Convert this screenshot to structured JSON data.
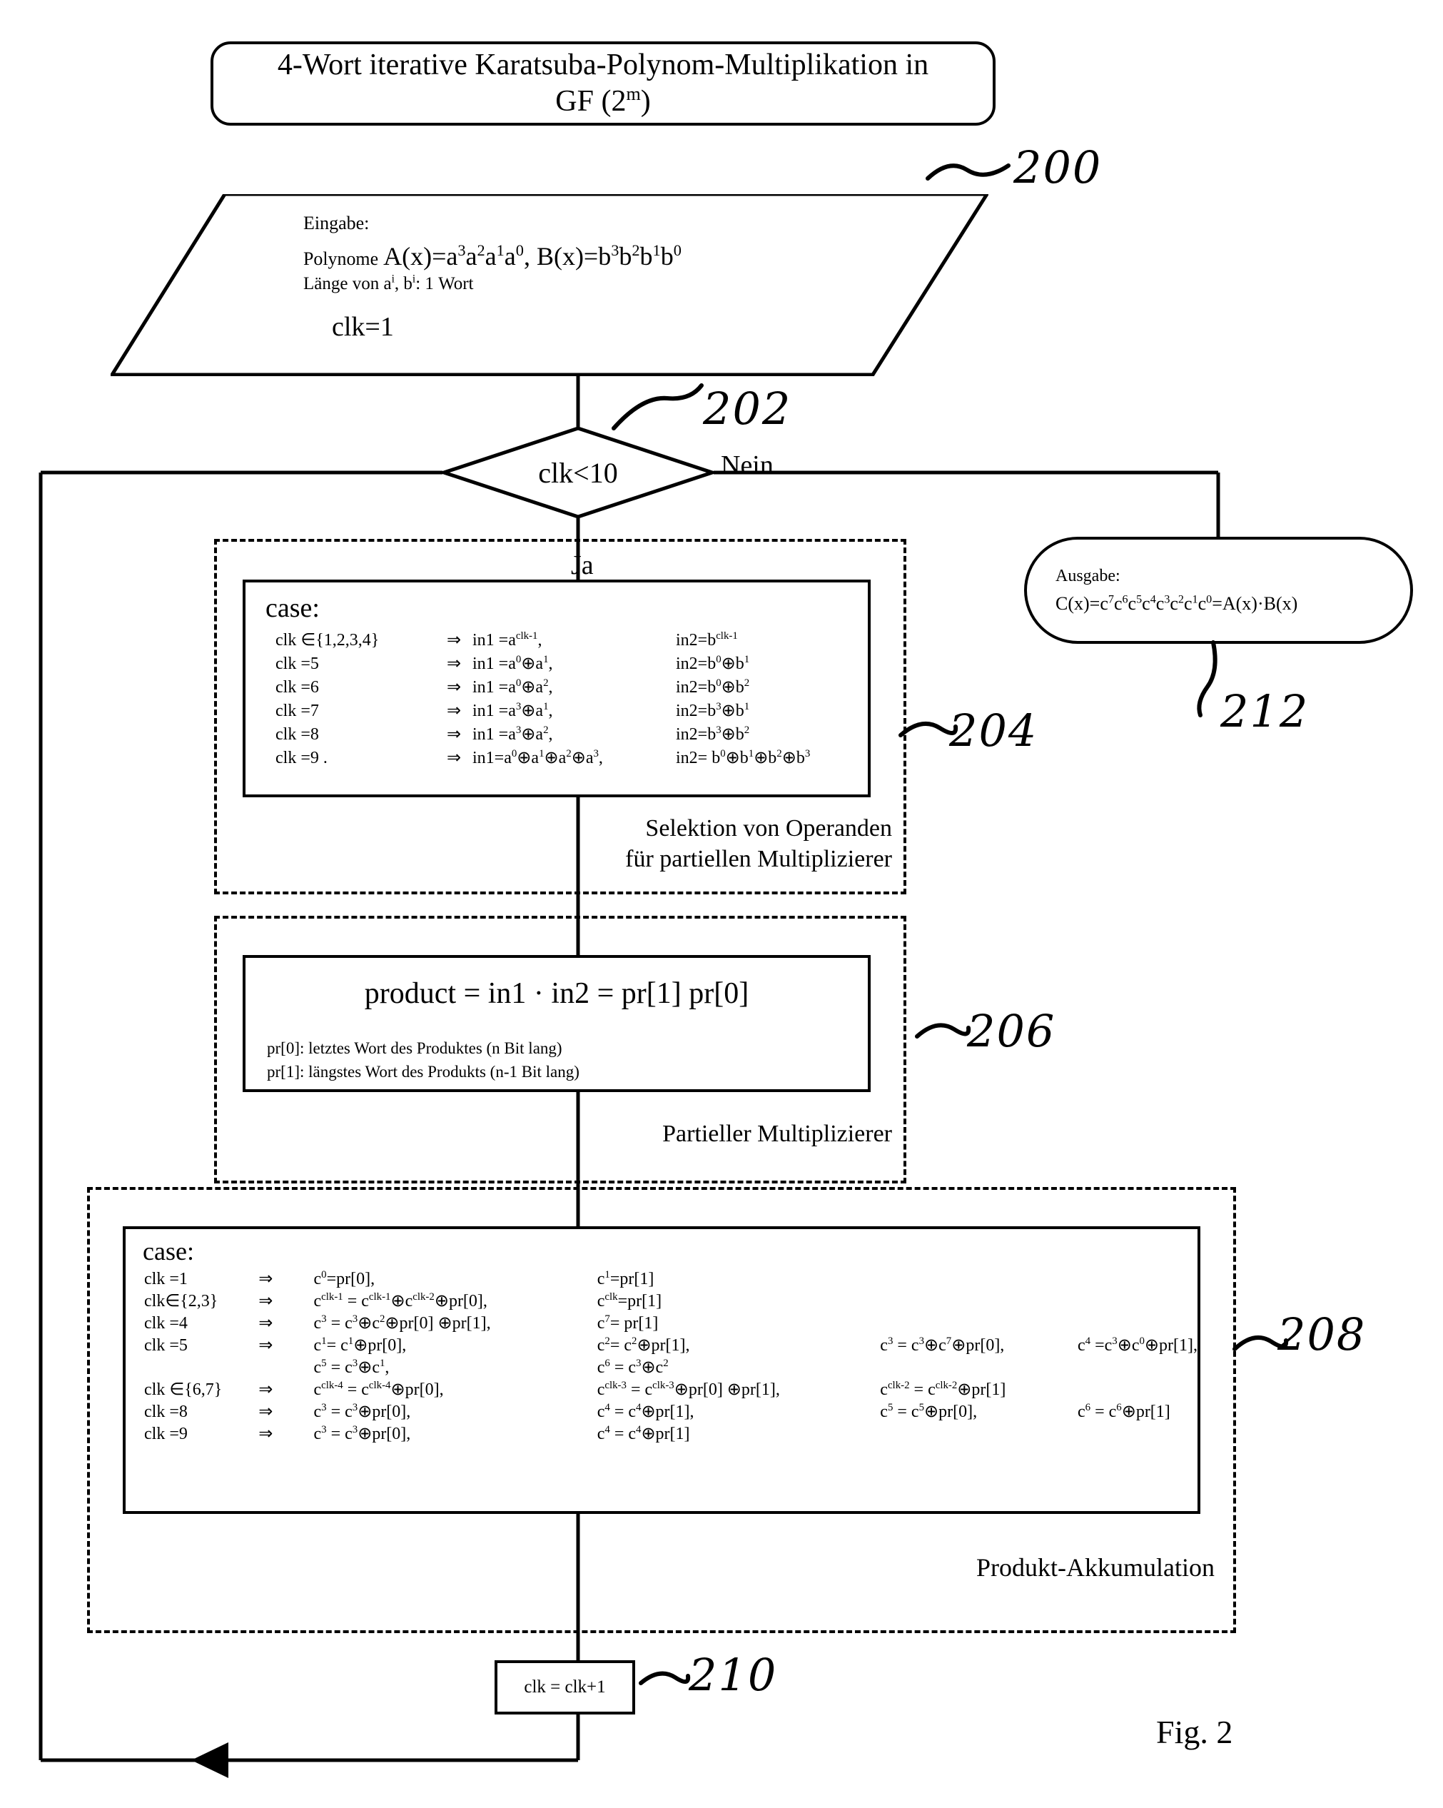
{
  "figure": {
    "caption": "Fig. 2",
    "title_line1": "4-Wort iterative Karatsuba-Polynom-Multiplikation in",
    "title_line2": "GF (2",
    "title_line2_sup": "m",
    "title_line2_end": ")"
  },
  "input_node": {
    "ref": "200",
    "label": "Eingabe:",
    "polynomials_prefix": "Polynome",
    "polynomials": "A(x)=a3a2a1a0, B(x)=b3b2b1b0",
    "length": "Länge von ai, bi: 1 Wort",
    "init": "clk=1"
  },
  "decision_node": {
    "ref": "202",
    "condition": "clk<10",
    "yes_label": "Ja",
    "no_label": "Nein"
  },
  "output_node": {
    "ref": "212",
    "label": "Ausgabe:",
    "expression": "C(x)=c7c6c5c4c3c2c1c0=A(x)·B(x)"
  },
  "operand_selection": {
    "ref": "204",
    "caption_line1": "Selektion von Operanden",
    "caption_line2": "für partiellen Multiplizierer",
    "case_keyword": "case:",
    "rows": [
      {
        "cond": "clk ∈{1,2,3,4}",
        "arrow": "⇒",
        "in1": "in1 =a^{clk-1},",
        "in2": "in2=b^{clk-1}"
      },
      {
        "cond": "clk =5",
        "arrow": "⇒",
        "in1": "in1 =a^{0}⊕a^{1},",
        "in2": "in2=b^{0}⊕b^{1}"
      },
      {
        "cond": "clk =6",
        "arrow": "⇒",
        "in1": "in1 =a^{0}⊕a^{2},",
        "in2": "in2=b^{0}⊕b^{2}"
      },
      {
        "cond": "clk =7",
        "arrow": "⇒",
        "in1": "in1 =a^{3}⊕a^{1},",
        "in2": "in2=b^{3}⊕b^{1}"
      },
      {
        "cond": "clk =8",
        "arrow": "⇒",
        "in1": "in1 =a^{3}⊕a^{2},",
        "in2": "in2=b^{3}⊕b^{2}"
      },
      {
        "cond": "clk =9 .",
        "arrow": "⇒",
        "in1": "in1=a^{0}⊕a^{1}⊕a^{2}⊕a^{3},",
        "in2": "in2= b^{0}⊕b^{1}⊕b^{2}⊕b^{3}"
      }
    ]
  },
  "partial_multiplier": {
    "ref": "206",
    "caption": "Partieller Multiplizierer",
    "equation": "product = in1 · in2 =  pr[1]  pr[0]",
    "note1": "pr[0]: letztes Wort des Produktes (n Bit lang)",
    "note2": "pr[1]: längstes Wort des Produkts (n-1 Bit lang)"
  },
  "product_accumulation": {
    "ref": "208",
    "caption": "Produkt-Akkumulation",
    "case_keyword": "case:",
    "rows": [
      {
        "cond": "clk =1",
        "arrow": "⇒",
        "e1": "c^{0}=pr[0],",
        "e2": "c^{1}=pr[1]",
        "e3": "",
        "e4": ""
      },
      {
        "cond": "clk∈{2,3}",
        "arrow": "⇒",
        "e1": "c^{clk-1} = c^{clk-1}⊕c^{clk-2}⊕pr[0],",
        "e2": "c^{clk}=pr[1]",
        "e3": "",
        "e4": ""
      },
      {
        "cond": "clk =4",
        "arrow": "⇒",
        "e1": "c^{3} = c^{3}⊕c^{2}⊕pr[0] ⊕pr[1],",
        "e2": "c^{7}= pr[1]",
        "e3": "",
        "e4": ""
      },
      {
        "cond": "clk =5",
        "arrow": "⇒",
        "e1": "c^{1}= c^{1}⊕pr[0],",
        "e2": "c^{2}= c^{2}⊕pr[1],",
        "e3": "c^{3} = c^{3}⊕c^{7}⊕pr[0],",
        "e4": "c^{4} =c^{3}⊕c^{0}⊕pr[1],"
      },
      {
        "cond": "",
        "arrow": "",
        "e1": "c^{5} = c^{3}⊕c^{1},",
        "e2": "c^{6} = c^{3}⊕c^{2}",
        "e3": "",
        "e4": ""
      },
      {
        "cond": "clk ∈{6,7}",
        "arrow": "⇒",
        "e1": "c^{clk-4} = c^{clk-4}⊕pr[0],",
        "e2": "c^{clk-3} = c^{clk-3}⊕pr[0] ⊕pr[1],",
        "e3": "c^{clk-2} = c^{clk-2}⊕pr[1]",
        "e4": ""
      },
      {
        "cond": "clk =8",
        "arrow": "⇒",
        "e1": "c^{3} = c^{3}⊕pr[0],",
        "e2": "c^{4} = c^{4}⊕pr[1],",
        "e3": "c^{5} = c^{5}⊕pr[0],",
        "e4": "c^{6} = c^{6}⊕pr[1]"
      },
      {
        "cond": "clk =9",
        "arrow": "⇒",
        "e1": "c^{3} = c^{3}⊕pr[0],",
        "e2": "c^{4} = c^{4}⊕pr[1]",
        "e3": "",
        "e4": ""
      }
    ]
  },
  "increment_node": {
    "ref": "210",
    "label": "clk = clk+1"
  },
  "colors": {
    "stroke": "#000000",
    "background": "#ffffff"
  }
}
